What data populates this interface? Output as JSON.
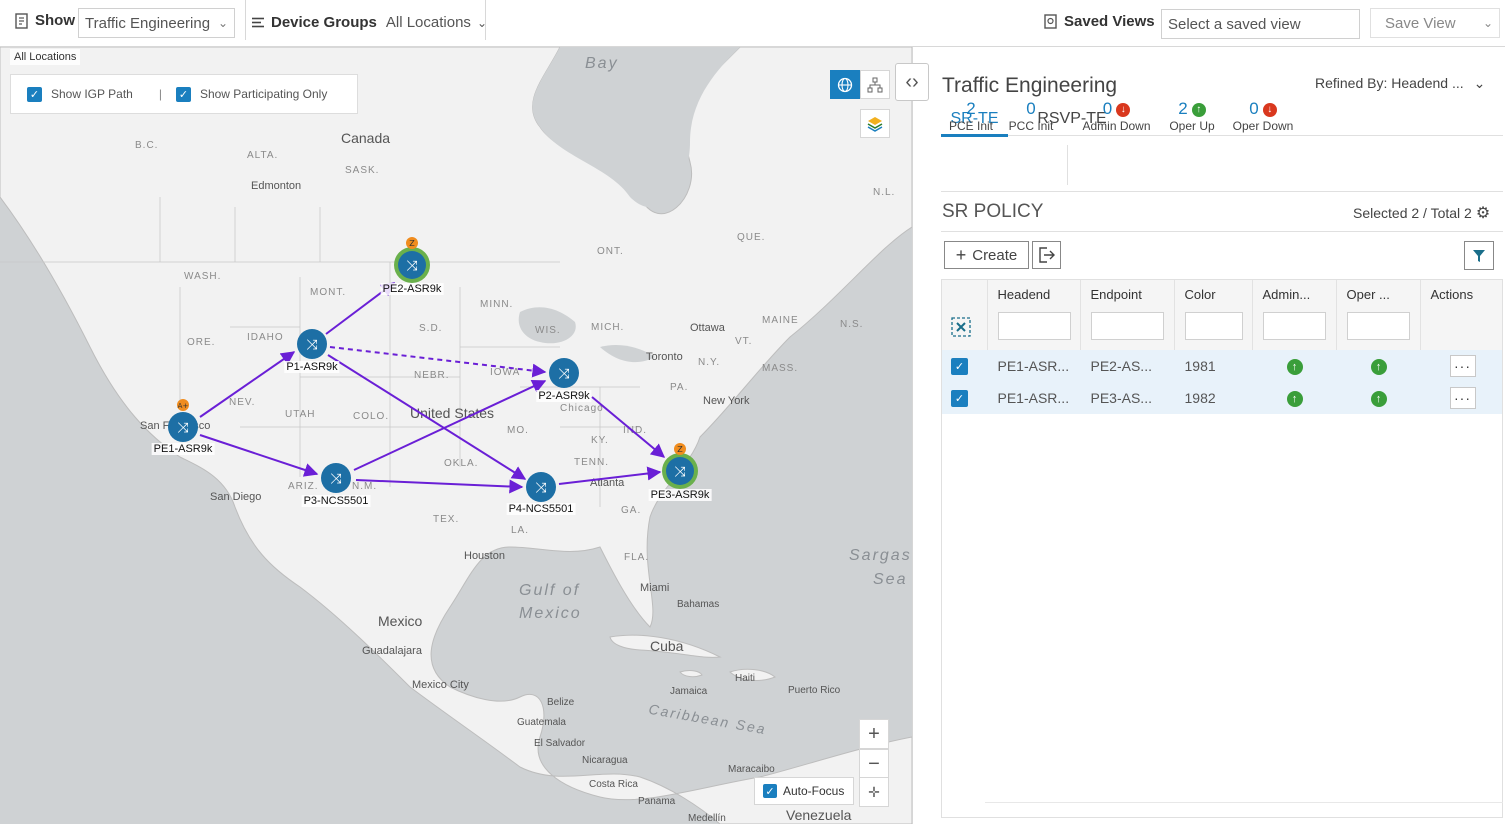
{
  "toolbar": {
    "show_label": "Show",
    "show_value": "Traffic Engineering",
    "device_groups_label": "Device Groups",
    "device_groups_value": "All Locations",
    "saved_views_label": "Saved Views",
    "saved_view_placeholder": "Select a saved view",
    "save_view_label": "Save View"
  },
  "map": {
    "all_locations": "All Locations",
    "show_igp_path": "Show IGP Path",
    "show_participating_only": "Show Participating Only",
    "auto_focus": "Auto-Focus",
    "labels": {
      "bay": "Bay",
      "canada": "Canada",
      "bc": "B.C.",
      "alta": "ALTA.",
      "sask": "SASK.",
      "edmonton": "Edmonton",
      "ont": "ONT.",
      "que": "QUE.",
      "nl": "N.L.",
      "wash": "WASH.",
      "mont": "MONT.",
      "idaho": "IDAHO",
      "ore": "ORE.",
      "minn": "MINN.",
      "sd": "S.D.",
      "wis": "WIS.",
      "mich": "MICH.",
      "ottawa": "Ottawa",
      "toronto": "Toronto",
      "ny": "N.Y.",
      "maine": "MAINE",
      "ns": "N.S.",
      "vt": "VT.",
      "mass": "MASS.",
      "pa": "PA.",
      "newyork": "New York",
      "nebr": "NEBR.",
      "iowa": "IOWA",
      "nev": "NEV.",
      "utah": "UTAH",
      "colo": "COLO.",
      "unitedstates": "United States",
      "mo": "MO.",
      "ind": "IND.",
      "ky": "KY.",
      "okla": "OKLA.",
      "tenn": "TENN.",
      "atlanta": "Atlanta",
      "ga": "GA.",
      "ariz": "ARIZ.",
      "nm": "N.M.",
      "sandiego": "San Diego",
      "sanfrancisco": "San Francisco",
      "tex": "TEX.",
      "la": "LA.",
      "houston": "Houston",
      "fla": "FLA.",
      "gulf1": "Gulf of",
      "gulf2": "Mexico",
      "miami": "Miami",
      "bahamas": "Bahamas",
      "sargas": "Sargas.",
      "sea": "Sea",
      "mexico": "Mexico",
      "guadalajara": "Guadalajara",
      "mexicocity": "Mexico City",
      "cuba": "Cuba",
      "jamaica": "Jamaica",
      "haiti": "Haiti",
      "puertorico": "Puerto Rico",
      "belize": "Belize",
      "guatemala": "Guatemala",
      "elsalvador": "El Salvador",
      "nicaragua": "Nicaragua",
      "costarica": "Costa Rica",
      "panama": "Panama",
      "caribbean1": "Caribbean Sea",
      "maracaibo": "Maracaibo",
      "medellin": "Medellín",
      "venezuela": "Venezuela",
      "chicago": "Chicago"
    },
    "nodes": {
      "pe1": "PE1-ASR9k",
      "pe2": "PE2-ASR9k",
      "p1": "P1-ASR9k",
      "p2": "P2-ASR9k",
      "p3": "P3-NCS5501",
      "p4": "P4-NCS5501",
      "pe3": "PE3-ASR9k"
    },
    "badges": {
      "a_end": "A+",
      "z_end": "Z"
    },
    "colors": {
      "link": "#6a1fd6",
      "node": "#1d6fa5",
      "endpoint_ring": "#6ab04c",
      "badge": "#f08c1e"
    }
  },
  "panel": {
    "title": "Traffic Engineering",
    "refined_by": "Refined By: Headend ...",
    "tabs": [
      "SR-TE",
      "RSVP-TE"
    ],
    "stats": [
      {
        "value": "2",
        "label": "PCE Init"
      },
      {
        "value": "0",
        "label": "PCC Init"
      },
      {
        "value": "0",
        "label": "Admin Down"
      },
      {
        "value": "2",
        "label": "Oper Up"
      },
      {
        "value": "0",
        "label": "Oper Down"
      }
    ],
    "section_title": "SR POLICY",
    "selected_total": "Selected 2 / Total 2",
    "create_label": "Create",
    "columns": [
      "Headend",
      "Endpoint",
      "Color",
      "Admin...",
      "Oper ...",
      "Actions"
    ],
    "rows": [
      {
        "headend": "PE1-ASR...",
        "endpoint": "PE2-AS...",
        "color": "1981"
      },
      {
        "headend": "PE1-ASR...",
        "endpoint": "PE3-AS...",
        "color": "1982"
      }
    ]
  }
}
